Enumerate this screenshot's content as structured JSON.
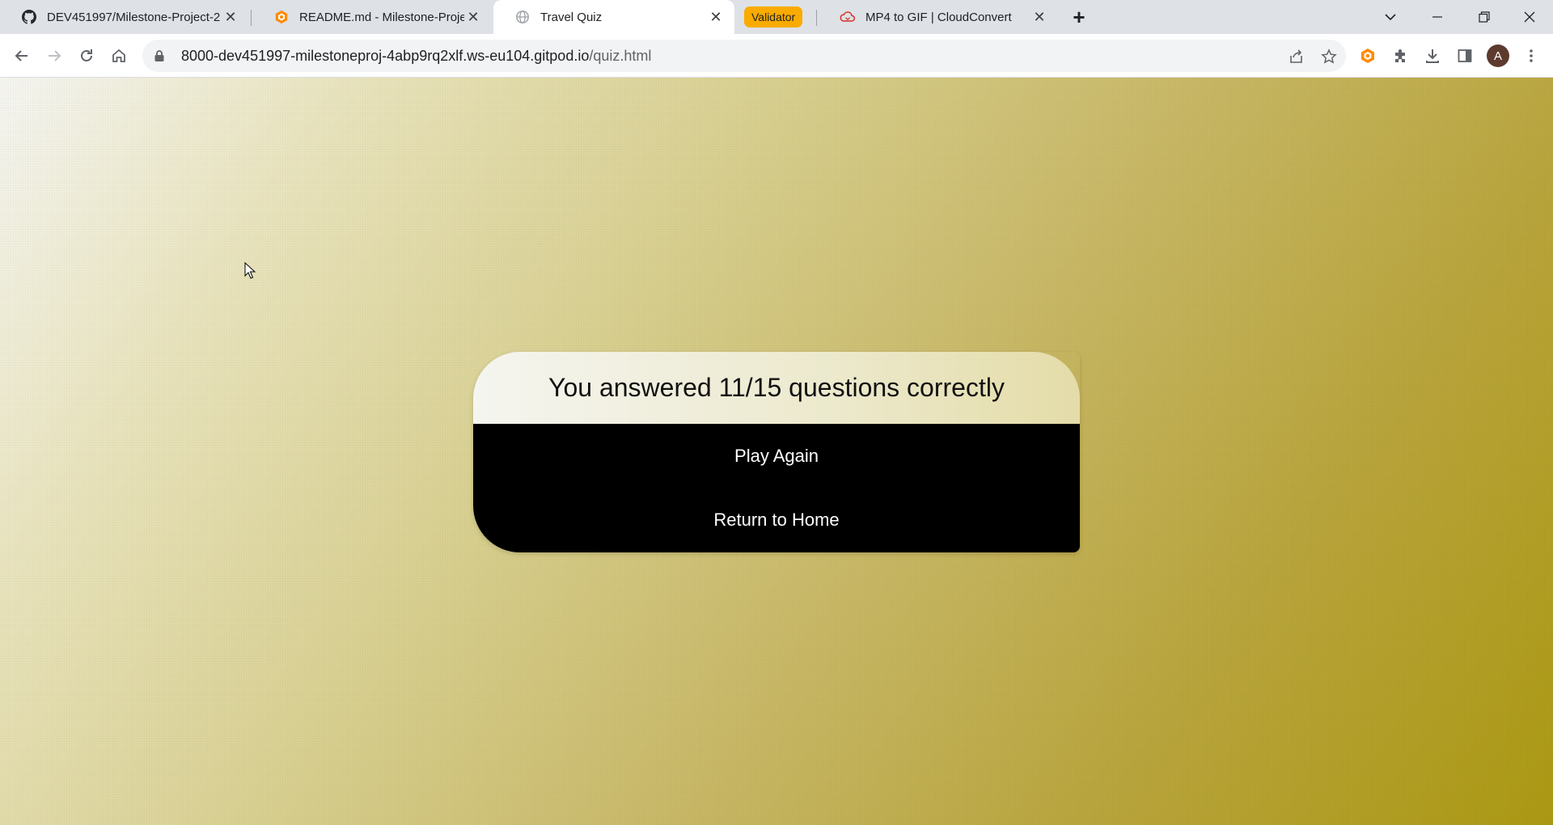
{
  "browser": {
    "tabs": [
      {
        "title": "DEV451997/Milestone-Project-2",
        "icon": "github-icon",
        "active": false
      },
      {
        "title": "README.md - Milestone-Project",
        "icon": "gitpod-icon",
        "active": false
      },
      {
        "title": "Travel Quiz",
        "icon": "globe-icon",
        "active": true
      },
      {
        "title": "MP4 to GIF | CloudConvert",
        "icon": "cloudconvert-icon",
        "active": false
      }
    ],
    "tab_group_label": "Validator",
    "tab_group_color": "#f9ab00",
    "url_host": "8000-dev451997-milestoneproj-4abp9rq2xlf.ws-eu104.gitpod.io",
    "url_path": "/quiz.html",
    "profile_initial": "A"
  },
  "quiz": {
    "result_text": "You answered 11/15 questions correctly",
    "play_again_label": "Play Again",
    "return_home_label": "Return to Home"
  },
  "colors": {
    "gradient_start": "#f6f6f2",
    "gradient_end": "#ac9a13",
    "card_body": "#000000"
  }
}
